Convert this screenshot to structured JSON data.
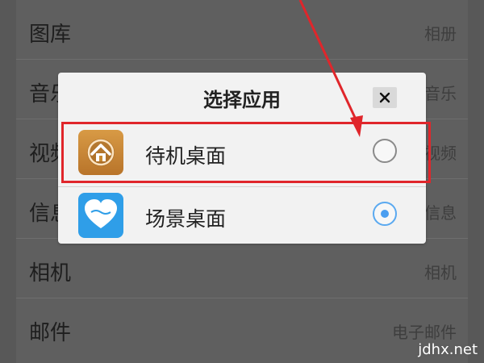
{
  "background_list": {
    "rows": [
      {
        "label": "图库",
        "value": "相册"
      },
      {
        "label": "音乐",
        "value": "音乐"
      },
      {
        "label": "视频",
        "value": "视频"
      },
      {
        "label": "信息",
        "value": "信息"
      },
      {
        "label": "相机",
        "value": "相机"
      },
      {
        "label": "邮件",
        "value": "电子邮件"
      }
    ]
  },
  "dialog": {
    "title": "选择应用",
    "close_icon": "close-icon",
    "options": [
      {
        "label": "待机桌面",
        "icon": "home-app-icon",
        "selected": false
      },
      {
        "label": "场景桌面",
        "icon": "heart-app-icon",
        "selected": true
      }
    ]
  },
  "annotation": {
    "color": "#e0262b"
  },
  "watermark": "jdhx.net",
  "colors": {
    "accent": "#4a9ef0",
    "home_icon": "#c98a32",
    "heart_icon": "#2f9ee8"
  }
}
